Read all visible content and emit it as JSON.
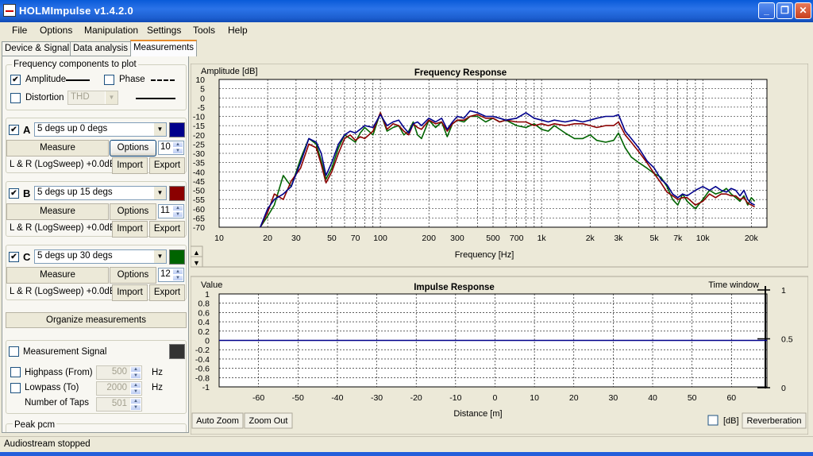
{
  "window": {
    "title": "HOLMImpulse  v1.4.2.0",
    "min": "_",
    "max": "❐",
    "close": "✕"
  },
  "menu": [
    "File",
    "Options",
    "Manipulation",
    "Settings",
    "Tools",
    "Help"
  ],
  "tabs": [
    "Device & Signal",
    "Data analysis",
    "Measurements"
  ],
  "freq_components": {
    "title": "Frequency components to plot",
    "amplitude": "Amplitude",
    "phase": "Phase",
    "distortion": "Distortion",
    "distortion_type": "THD"
  },
  "measurements": [
    {
      "letter": "A",
      "name": "5 degs up 0 degs",
      "color": "#00008b",
      "measure": "Measure",
      "options": "Options",
      "count": "10",
      "info": "L & R (LogSweep) +0.0dB",
      "import": "Import",
      "export": "Export"
    },
    {
      "letter": "B",
      "name": "5 degs up 15 degs",
      "color": "#8b0000",
      "measure": "Measure",
      "options": "Options",
      "count": "11",
      "info": "L & R (LogSweep) +0.0dB",
      "import": "Import",
      "export": "Export"
    },
    {
      "letter": "C",
      "name": "5 degs up 30 degs",
      "color": "#006400",
      "measure": "Measure",
      "options": "Options",
      "count": "12",
      "info": "L & R (LogSweep) +0.0dB",
      "import": "Import",
      "export": "Export"
    }
  ],
  "organize": "Organize measurements",
  "signal": {
    "measurement_signal": "Measurement Signal",
    "highpass_label": "Highpass (From)",
    "highpass_value": "500",
    "hz1": "Hz",
    "lowpass_label": "Lowpass (To)",
    "lowpass_value": "2000",
    "hz2": "Hz",
    "taps_label": "Number of Taps",
    "taps_value": "501",
    "peak_label": "Peak pcm"
  },
  "up_arrow": "▲",
  "down_arrow": "▼",
  "chart_data": [
    {
      "type": "line",
      "title": "Frequency Response",
      "ylabel": "Amplitude [dB]",
      "xlabel": "Frequency [Hz]",
      "xscale": "log",
      "xlim": [
        10,
        25000
      ],
      "ylim": [
        -70,
        10
      ],
      "yticks": [
        "10",
        "5",
        "0",
        "-5",
        "-10",
        "-15",
        "-20",
        "-25",
        "-30",
        "-35",
        "-40",
        "-45",
        "-50",
        "-55",
        "-60",
        "-65",
        "-70"
      ],
      "xticks": [
        "10",
        "20",
        "30",
        "50",
        "70",
        "100",
        "200",
        "300",
        "500",
        "700",
        "1k",
        "2k",
        "3k",
        "5k",
        "7k",
        "10k",
        "20k"
      ],
      "xtick_values": [
        10,
        20,
        30,
        50,
        70,
        100,
        200,
        300,
        500,
        700,
        1000,
        2000,
        3000,
        5000,
        7000,
        10000,
        20000
      ],
      "grid": true,
      "series": [
        {
          "color": "#006400",
          "x": [
            18,
            20,
            22,
            25,
            28,
            32,
            36,
            40,
            43,
            46,
            50,
            55,
            60,
            65,
            70,
            75,
            80,
            90,
            100,
            110,
            120,
            130,
            140,
            150,
            160,
            170,
            180,
            200,
            220,
            240,
            260,
            280,
            300,
            330,
            360,
            400,
            450,
            500,
            550,
            600,
            700,
            800,
            900,
            1000,
            1100,
            1200,
            1400,
            1600,
            1800,
            2000,
            2200,
            2500,
            2800,
            3000,
            3300,
            3600,
            4000,
            4500,
            5000,
            5500,
            6000,
            6500,
            7000,
            7500,
            8000,
            9000,
            10000,
            11000,
            12000,
            13000,
            14000,
            15000,
            16000,
            17000,
            18000,
            19000,
            20000,
            21000
          ],
          "y": [
            -70,
            -64,
            -58,
            -42,
            -48,
            -33,
            -22,
            -25,
            -34,
            -44,
            -38,
            -27,
            -20,
            -22,
            -24,
            -19,
            -16,
            -20,
            -8,
            -18,
            -16,
            -15,
            -20,
            -18,
            -13,
            -20,
            -22,
            -12,
            -16,
            -13,
            -21,
            -14,
            -12,
            -13,
            -10,
            -10,
            -13,
            -11,
            -13,
            -12,
            -15,
            -16,
            -14,
            -17,
            -18,
            -15,
            -19,
            -22,
            -22,
            -20,
            -23,
            -24,
            -23,
            -19,
            -27,
            -32,
            -35,
            -38,
            -41,
            -43,
            -48,
            -55,
            -58,
            -52,
            -56,
            -60,
            -55,
            -50,
            -52,
            -51,
            -49,
            -52,
            -54,
            -56,
            -53,
            -58,
            -54,
            -56
          ]
        },
        {
          "color": "#8b0000",
          "x": [
            18,
            20,
            22,
            25,
            28,
            32,
            36,
            40,
            43,
            46,
            50,
            55,
            60,
            65,
            70,
            75,
            80,
            90,
            100,
            110,
            120,
            130,
            140,
            150,
            160,
            170,
            180,
            200,
            220,
            240,
            260,
            280,
            300,
            330,
            360,
            400,
            450,
            500,
            550,
            600,
            700,
            800,
            900,
            1000,
            1100,
            1200,
            1400,
            1600,
            1800,
            2000,
            2200,
            2500,
            2800,
            3000,
            3300,
            3600,
            4000,
            4500,
            5000,
            5500,
            6000,
            6500,
            7000,
            7500,
            8000,
            9000,
            10000,
            11000,
            12000,
            13000,
            14000,
            15000,
            16000,
            17000,
            18000,
            19000,
            20000,
            21000
          ],
          "y": [
            -70,
            -62,
            -52,
            -55,
            -45,
            -38,
            -25,
            -27,
            -36,
            -46,
            -40,
            -30,
            -22,
            -20,
            -23,
            -21,
            -22,
            -18,
            -8,
            -17,
            -14,
            -15,
            -18,
            -20,
            -14,
            -16,
            -17,
            -12,
            -14,
            -13,
            -18,
            -14,
            -12,
            -12,
            -10,
            -9,
            -11,
            -11,
            -13,
            -12,
            -13,
            -13,
            -15,
            -14,
            -15,
            -14,
            -15,
            -14,
            -14,
            -15,
            -16,
            -15,
            -15,
            -13,
            -20,
            -24,
            -29,
            -35,
            -41,
            -46,
            -51,
            -53,
            -55,
            -54,
            -54,
            -58,
            -56,
            -52,
            -54,
            -52,
            -52,
            -53,
            -53,
            -55,
            -54,
            -57,
            -58,
            -59
          ]
        },
        {
          "color": "#00008b",
          "x": [
            18,
            20,
            22,
            25,
            28,
            32,
            36,
            40,
            43,
            46,
            50,
            55,
            60,
            65,
            70,
            75,
            80,
            90,
            100,
            110,
            120,
            130,
            140,
            150,
            160,
            170,
            180,
            200,
            220,
            240,
            260,
            280,
            300,
            330,
            360,
            400,
            450,
            500,
            550,
            600,
            700,
            800,
            900,
            1000,
            1100,
            1200,
            1400,
            1600,
            1800,
            2000,
            2200,
            2500,
            2800,
            3000,
            3300,
            3600,
            4000,
            4500,
            5000,
            5500,
            6000,
            6500,
            7000,
            7500,
            8000,
            9000,
            10000,
            11000,
            12000,
            13000,
            14000,
            15000,
            16000,
            17000,
            18000,
            19000,
            20000,
            21000
          ],
          "y": [
            -70,
            -60,
            -55,
            -52,
            -48,
            -35,
            -22,
            -24,
            -30,
            -42,
            -35,
            -25,
            -20,
            -18,
            -19,
            -17,
            -15,
            -16,
            -9,
            -15,
            -13,
            -12,
            -16,
            -19,
            -14,
            -13,
            -15,
            -11,
            -13,
            -11,
            -17,
            -13,
            -10,
            -11,
            -7,
            -8,
            -10,
            -10,
            -11,
            -12,
            -11,
            -8,
            -11,
            -12,
            -13,
            -12,
            -13,
            -12,
            -13,
            -12,
            -11,
            -10,
            -10,
            -9,
            -18,
            -22,
            -27,
            -34,
            -38,
            -44,
            -47,
            -52,
            -54,
            -52,
            -53,
            -50,
            -48,
            -50,
            -48,
            -50,
            -51,
            -49,
            -50,
            -53,
            -50,
            -55,
            -57,
            -58
          ]
        }
      ]
    },
    {
      "type": "line",
      "title": "Impulse Response",
      "ylabel": "Value",
      "y2label": "Time window",
      "xlabel": "Distance [m]",
      "xlim": [
        -70,
        69
      ],
      "ylim": [
        -1,
        1
      ],
      "yticks": [
        "1",
        "0.8",
        "0.6",
        "0.4",
        "0.2",
        "0",
        "-0.2",
        "-0.4",
        "-0.6",
        "-0.8",
        "-1"
      ],
      "y2ticks": [
        "1",
        "0.5",
        "0"
      ],
      "xticks": [
        "-60",
        "-50",
        "-40",
        "-30",
        "-20",
        "-10",
        "0",
        "10",
        "20",
        "30",
        "40",
        "50",
        "60"
      ],
      "grid": true,
      "series": [
        {
          "color": "#00008b",
          "x": [
            -70,
            69
          ],
          "y": [
            0,
            0
          ]
        }
      ]
    }
  ],
  "impulse_controls": {
    "auto_zoom": "Auto Zoom",
    "zoom_out": "Zoom Out",
    "db": "[dB]",
    "reverberation": "Reverberation"
  },
  "status": "Audiostream stopped"
}
